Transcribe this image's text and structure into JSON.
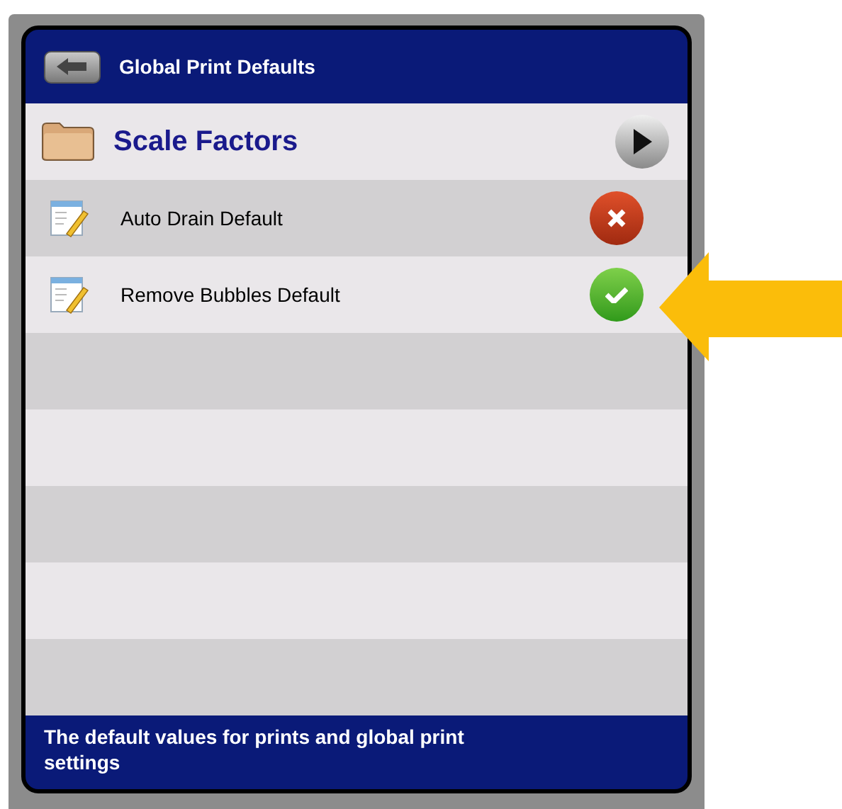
{
  "header": {
    "title": "Global Print Defaults"
  },
  "section": {
    "title": "Scale Factors"
  },
  "settings": [
    {
      "label": "Auto Drain Default",
      "on": false
    },
    {
      "label": "Remove Bubbles Default",
      "on": true
    }
  ],
  "footer": {
    "text": "The default values for prints and global print settings"
  }
}
